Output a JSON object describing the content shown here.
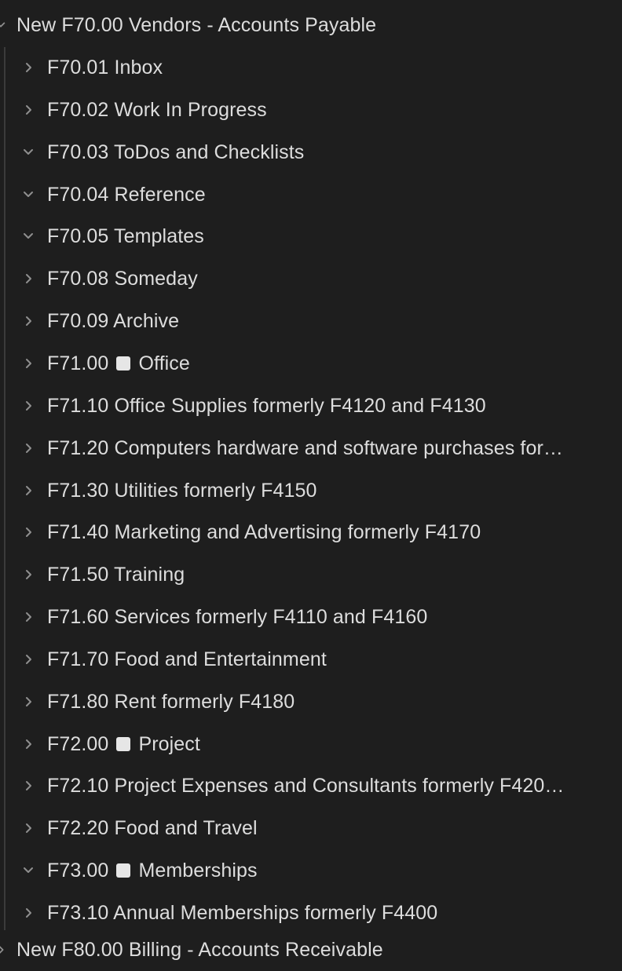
{
  "tree": {
    "root": {
      "label": "New F70.00 Vendors - Accounts Payable",
      "expanded": true
    },
    "items": [
      {
        "code": "F70.01",
        "label": "F70.01 Inbox",
        "expanded": false
      },
      {
        "code": "F70.02",
        "label": "F70.02 Work In Progress",
        "expanded": false
      },
      {
        "code": "F70.03",
        "label": "F70.03 ToDos and Checklists",
        "expanded": true
      },
      {
        "code": "F70.04",
        "label": "F70.04 Reference",
        "expanded": true
      },
      {
        "code": "F70.05",
        "label": "F70.05 Templates",
        "expanded": true
      },
      {
        "code": "F70.08",
        "label": "F70.08 Someday",
        "expanded": false
      },
      {
        "code": "F70.09",
        "label": "F70.09 Archive",
        "expanded": false
      },
      {
        "code": "F71.00",
        "label": "Office",
        "prefix": "F71.00",
        "square": true,
        "expanded": false
      },
      {
        "code": "F71.10",
        "label": "F71.10 Office Supplies formerly F4120 and F4130",
        "expanded": false
      },
      {
        "code": "F71.20",
        "label": "F71.20 Computers hardware and software purchases for…",
        "expanded": false
      },
      {
        "code": "F71.30",
        "label": "F71.30 Utilities formerly F4150",
        "expanded": false
      },
      {
        "code": "F71.40",
        "label": "F71.40 Marketing and Advertising formerly F4170",
        "expanded": false
      },
      {
        "code": "F71.50",
        "label": "F71.50 Training",
        "expanded": false
      },
      {
        "code": "F71.60",
        "label": "F71.60 Services formerly F4110 and F4160",
        "expanded": false
      },
      {
        "code": "F71.70",
        "label": "F71.70 Food and Entertainment",
        "expanded": false
      },
      {
        "code": "F71.80",
        "label": "F71.80 Rent formerly F4180",
        "expanded": false
      },
      {
        "code": "F72.00",
        "label": "Project",
        "prefix": "F72.00",
        "square": true,
        "expanded": false
      },
      {
        "code": "F72.10",
        "label": "F72.10 Project Expenses and Consultants formerly F420…",
        "expanded": false
      },
      {
        "code": "F72.20",
        "label": "F72.20 Food and Travel",
        "expanded": false
      },
      {
        "code": "F73.00",
        "label": "Memberships",
        "prefix": "F73.00",
        "square": true,
        "expanded": true
      },
      {
        "code": "F73.10",
        "label": "F73.10 Annual Memberships formerly F4400",
        "expanded": false
      }
    ],
    "next_root": {
      "label": "New F80.00 Billing - Accounts Receivable"
    }
  },
  "colors": {
    "background": "#1e1e1e",
    "text": "#dddddd",
    "chevron": "#8f8f8f",
    "guide": "#3b3b3b",
    "square": "#e6e6e6"
  }
}
